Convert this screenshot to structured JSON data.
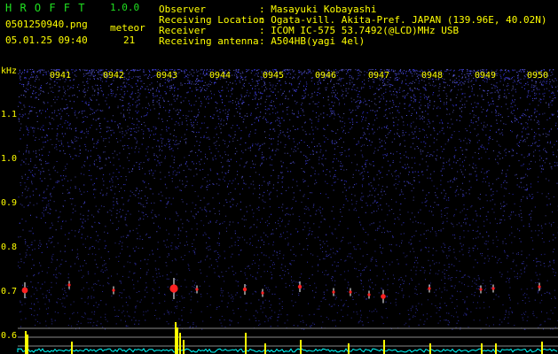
{
  "header": {
    "app_title": "H R O F F T",
    "version": "1.0.0",
    "filename": "0501250940.png",
    "meteor_label": "meteor",
    "datetime": "05.01.25 09:40",
    "meteor_count": "21",
    "info": [
      {
        "key": "Observer",
        "value": ": Masayuki Kobayashi"
      },
      {
        "key": "Receiving Location",
        "value": ": Ogata-vill. Akita-Pref. JAPAN (139.96E, 40.02N)"
      },
      {
        "key": "Receiver",
        "value": ": ICOM IC-575 53.7492(@LCD)MHz USB"
      },
      {
        "key": "Receiving antenna",
        "value": ": A504HB(yagi 4el)"
      }
    ]
  },
  "spectrogram": {
    "unit": "kHz",
    "time_ticks": [
      "0941",
      "0942",
      "0943",
      "0944",
      "0945",
      "0946",
      "0947",
      "0948",
      "0949",
      "0950"
    ],
    "freq_ticks": [
      "1.1",
      "1.0",
      "0.9",
      "0.8",
      "0.7",
      "0.6"
    ]
  },
  "colors": {
    "text_yellow": "#ffff00",
    "text_green": "#20e020",
    "background": "#000000",
    "noise_blue": "#3a3aff",
    "echo_red": "#ff2020",
    "signal_cyan": "#00ffff"
  }
}
